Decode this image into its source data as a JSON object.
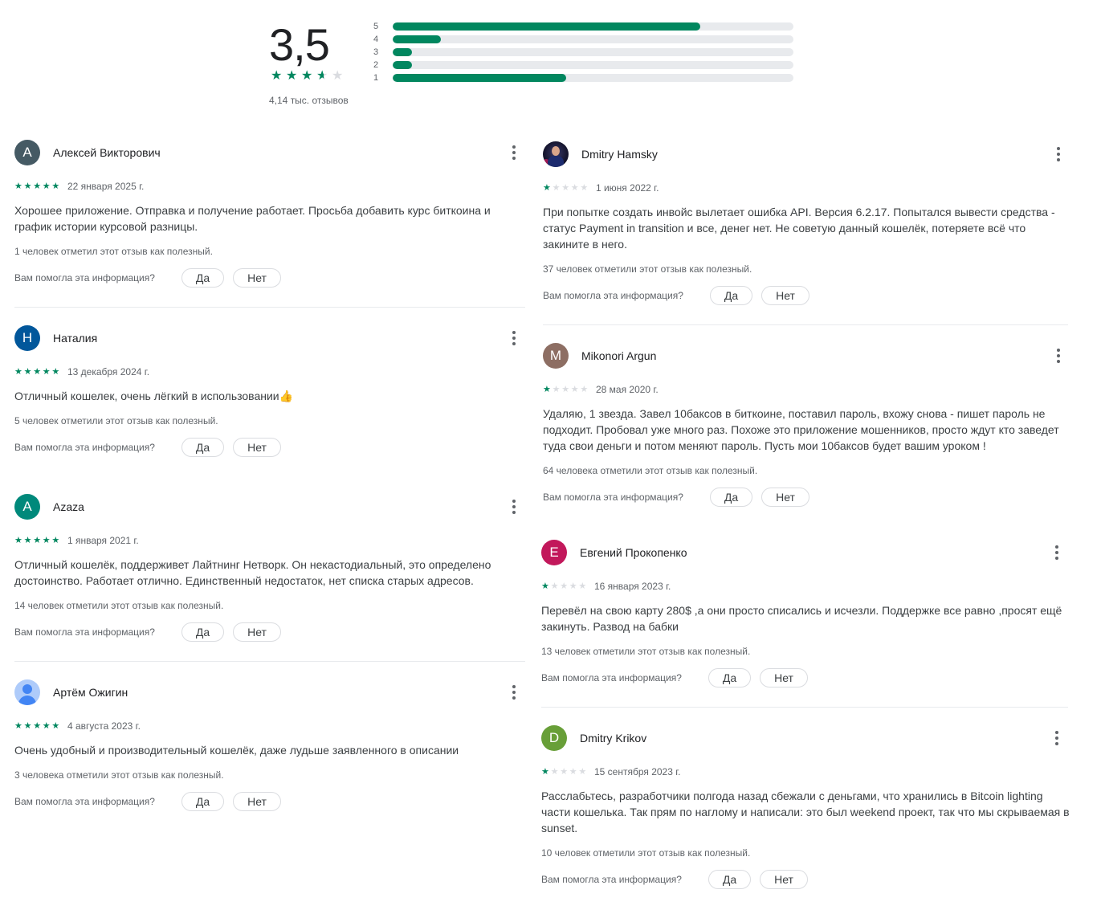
{
  "summary": {
    "rating": "3,5",
    "rating_value": 3.5,
    "total_reviews": "4,14 тыс. отзывов",
    "distribution": [
      {
        "label": "5",
        "fraction": 0.767
      },
      {
        "label": "4",
        "fraction": 0.12
      },
      {
        "label": "3",
        "fraction": 0.048
      },
      {
        "label": "2",
        "fraction": 0.048
      },
      {
        "label": "1",
        "fraction": 0.433
      }
    ]
  },
  "colors": {
    "accent": "#01875f",
    "star_off": "#dadce0",
    "bar_track": "#e8eaed"
  },
  "labels": {
    "helpful_question": "Вам помогла эта информация?",
    "yes": "Да",
    "no": "Нет"
  },
  "reviews": [
    {
      "name": "Алексей Викторович",
      "avatar": {
        "type": "letter",
        "letter": "A",
        "color": "#455a64"
      },
      "stars": 5,
      "date": "22 января 2025 г.",
      "text": "Хорошее приложение. Отправка и получение работает. Просьба добавить курс биткоина и график истории курсовой разницы.",
      "helpful": "1 человек отметил этот отзыв как полезный."
    },
    {
      "name": "Наталия",
      "avatar": {
        "type": "letter",
        "letter": "Н",
        "color": "#01579b"
      },
      "stars": 5,
      "date": "13 декабря 2024 г.",
      "text": "Отличный кошелек, очень лёгкий в использовании👍",
      "helpful": "5 человек отметили этот отзыв как полезный."
    },
    {
      "name": "Azaza",
      "avatar": {
        "type": "letter",
        "letter": "A",
        "color": "#00897b"
      },
      "stars": 5,
      "date": "1 января 2021 г.",
      "text": "Отличный кошелёк, поддерживет Лайтнинг Нетворк. Он некастодиальный, это определено достоинство. Работает отлично. Единственный недостаток, нет списка старых адресов.",
      "helpful": "14 человек отметили этот отзыв как полезный."
    },
    {
      "name": "Артём Ожигин",
      "avatar": {
        "type": "default-user",
        "icon": "user-silhouette-icon"
      },
      "stars": 5,
      "date": "4 августа 2023 г.",
      "text": "Очень удобный и производительный кошелёк, даже лудьше заявленного в описании",
      "helpful": "3 человека отметили этот отзыв как полезный."
    },
    {
      "name": "Dmitry Hamsky",
      "avatar": {
        "type": "photo",
        "icon": "profile-photo"
      },
      "stars": 1,
      "date": "1 июня 2022 г.",
      "text": "При попытке создать инвойс вылетает ошибка API. Версия 6.2.17. Попытался вывести средства - статус Payment in transition и все, денег нет. Не советую данный кошелёк, потеряете всё что закините в него.",
      "helpful": "37 человек отметили этот отзыв как полезный."
    },
    {
      "name": "Mikonori Argun",
      "avatar": {
        "type": "letter",
        "letter": "M",
        "color": "#8d6e63"
      },
      "stars": 1,
      "date": "28 мая 2020 г.",
      "text": "Удаляю, 1 звезда. Завел 10баксов в биткоине, поставил пароль, вхожу снова - пишет пароль не подходит. Пробовал уже много раз. Похоже это приложение мошенников, просто ждут кто заведет туда свои деньги и потом меняют пароль. Пусть мои 10баксов будет вашим уроком !",
      "helpful": "64 человека отметили этот отзыв как полезный."
    },
    {
      "name": "Евгений Прокопенко",
      "avatar": {
        "type": "letter",
        "letter": "E",
        "color": "#c2185b"
      },
      "stars": 1,
      "date": "16 января 2023 г.",
      "text": "Перевёл на свою карту 280$ ,а они просто списались и исчезли. Поддержке все равно ,просят ещё закинуть. Развод на бабки",
      "helpful": "13 человек отметили этот отзыв как полезный."
    },
    {
      "name": "Dmitry Krikov",
      "avatar": {
        "type": "letter",
        "letter": "D",
        "color": "#689f38"
      },
      "stars": 1,
      "date": "15 сентября 2023 г.",
      "text": "Расслабьтесь, разработчики полгода назад сбежали с деньгами, что хранились в Bitcoin lighting части кошелька. Так прям по наглому и написали: это был weekend проект, так что мы скрываемая в sunset.",
      "helpful": "10 человек отметили этот отзыв как полезный."
    }
  ]
}
